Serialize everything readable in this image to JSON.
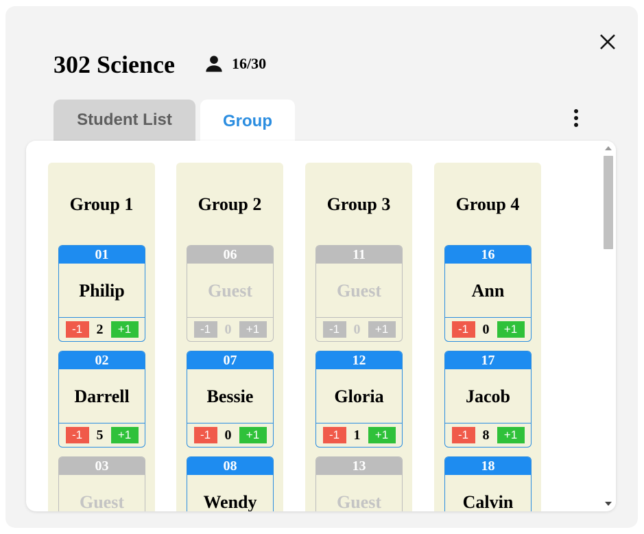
{
  "header": {
    "title": "302 Science",
    "count": "16/30"
  },
  "tabs": [
    {
      "label": "Student List"
    },
    {
      "label": "Group"
    }
  ],
  "controls": {
    "minus_label": "-1",
    "plus_label": "+1"
  },
  "colors": {
    "accent": "#1e8cf0",
    "minus": "#f05a4a",
    "plus": "#2fc13a",
    "disabled": "#bdbdbd",
    "group_bg": "#f3f2dc"
  },
  "groups": [
    {
      "name": "Group 1",
      "students": [
        {
          "number": "01",
          "name": "Philip",
          "score": "2",
          "active": true
        },
        {
          "number": "02",
          "name": "Darrell",
          "score": "5",
          "active": true
        },
        {
          "number": "03",
          "name": "Guest",
          "score": "",
          "active": false
        }
      ]
    },
    {
      "name": "Group 2",
      "students": [
        {
          "number": "06",
          "name": "Guest",
          "score": "0",
          "active": false
        },
        {
          "number": "07",
          "name": "Bessie",
          "score": "0",
          "active": true
        },
        {
          "number": "08",
          "name": "Wendy",
          "score": "",
          "active": true
        }
      ]
    },
    {
      "name": "Group 3",
      "students": [
        {
          "number": "11",
          "name": "Guest",
          "score": "0",
          "active": false
        },
        {
          "number": "12",
          "name": "Gloria",
          "score": "1",
          "active": true
        },
        {
          "number": "13",
          "name": "Guest",
          "score": "",
          "active": false
        }
      ]
    },
    {
      "name": "Group 4",
      "students": [
        {
          "number": "16",
          "name": "Ann",
          "score": "0",
          "active": true
        },
        {
          "number": "17",
          "name": "Jacob",
          "score": "8",
          "active": true
        },
        {
          "number": "18",
          "name": "Calvin",
          "score": "",
          "active": true
        }
      ]
    }
  ]
}
